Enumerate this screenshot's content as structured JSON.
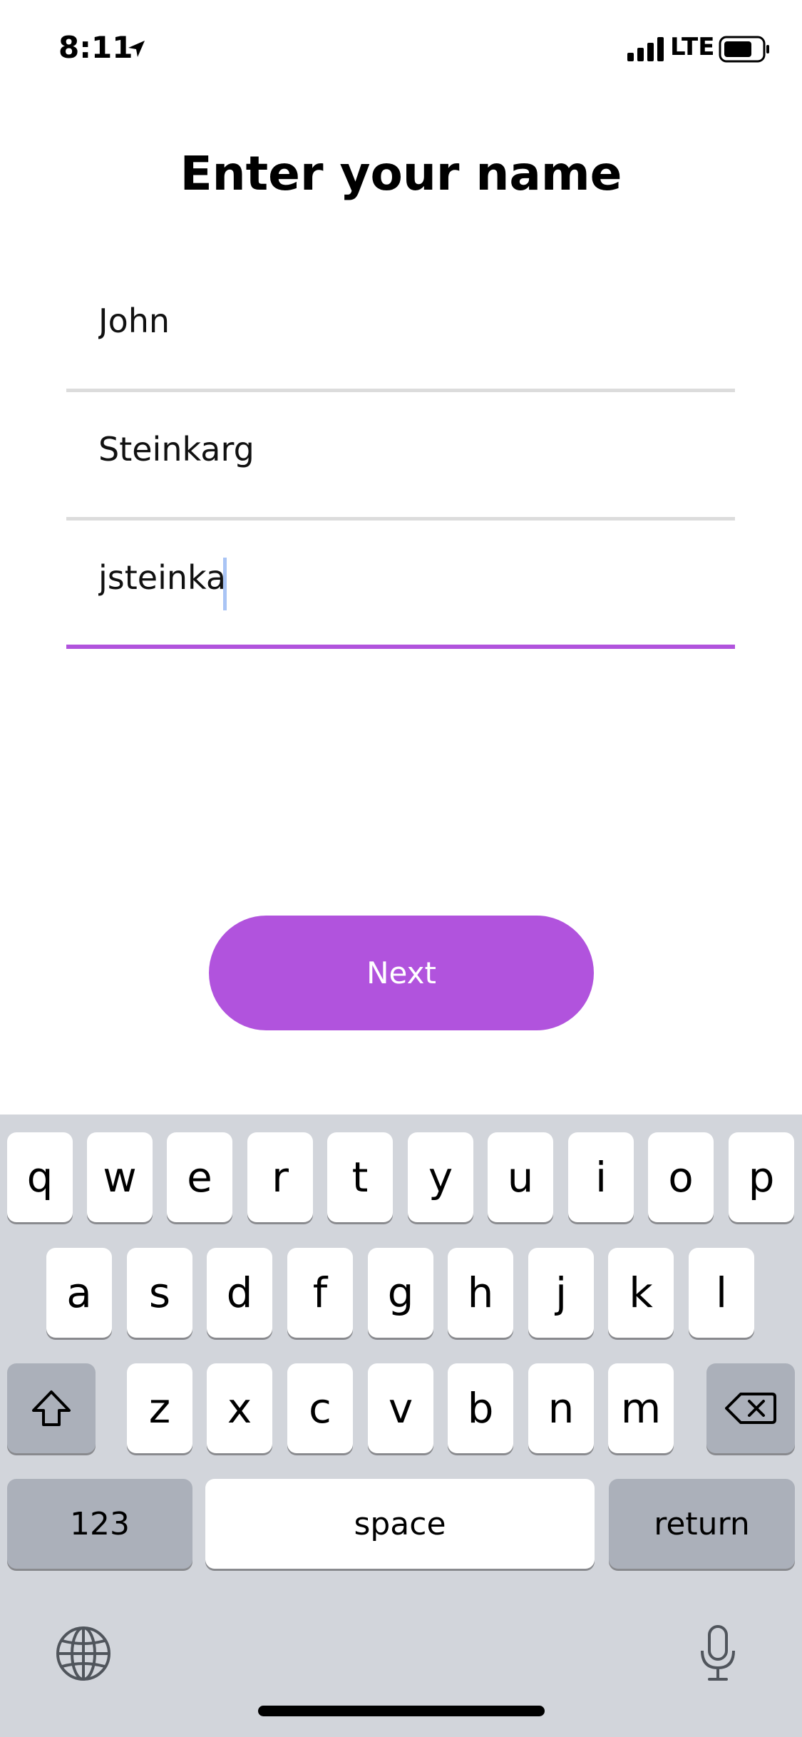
{
  "status_bar": {
    "time": "8:11",
    "network": "LTE"
  },
  "title": "Enter your name",
  "fields": [
    {
      "name": "first-name",
      "value": "John"
    },
    {
      "name": "last-name",
      "value": "Steinkarg"
    },
    {
      "name": "username",
      "value": "jsteinka"
    }
  ],
  "next_label": "Next",
  "keyboard": {
    "row1": [
      "q",
      "w",
      "e",
      "r",
      "t",
      "y",
      "u",
      "i",
      "o",
      "p"
    ],
    "row2": [
      "a",
      "s",
      "d",
      "f",
      "g",
      "h",
      "j",
      "k",
      "l"
    ],
    "row3": [
      "z",
      "x",
      "c",
      "v",
      "b",
      "n",
      "m"
    ],
    "numbers_label": "123",
    "space_label": "space",
    "return_label": "return"
  },
  "colors": {
    "accent": "#b153dd",
    "keyboard_bg": "#d2d5db",
    "dark_key": "#abb0ba"
  },
  "icons": [
    "location-arrow-icon",
    "signal-icon",
    "battery-icon",
    "shift-icon",
    "backspace-icon",
    "globe-icon",
    "microphone-icon"
  ]
}
